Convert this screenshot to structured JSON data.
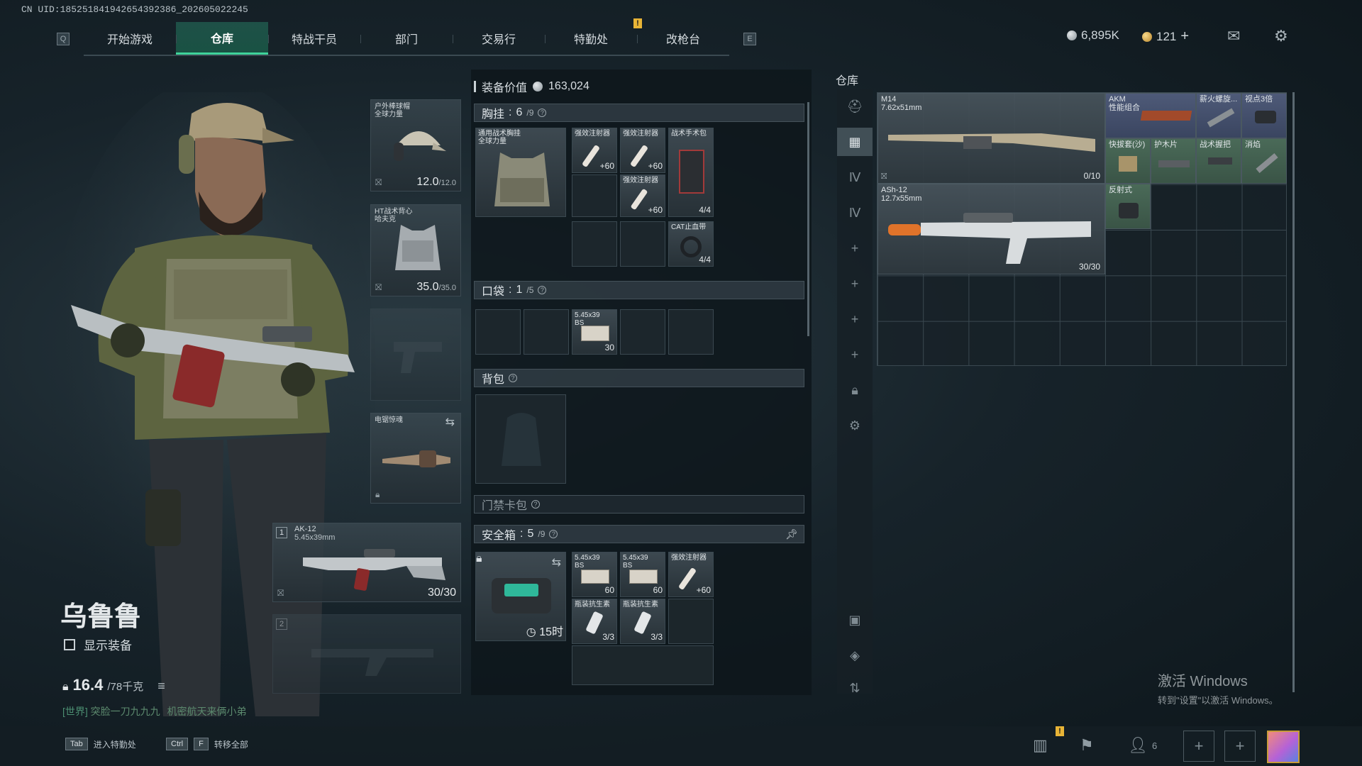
{
  "uid_text": "CN UID:185251841942654392386_202605022245",
  "nav": {
    "left_key": "Q",
    "right_key": "E",
    "tabs": [
      "开始游戏",
      "仓库",
      "特战干员",
      "部门",
      "交易行",
      "特勤处",
      "改枪台"
    ],
    "active_tab": "仓库",
    "warn_mark": "!"
  },
  "currency": {
    "silver": "6,895K",
    "gold": "121",
    "gold_plus": "+"
  },
  "operator": {
    "name": "乌鲁鲁",
    "show_gear_label": "显示装备",
    "weight": "16.4",
    "weight_max": "/78千克"
  },
  "chat": {
    "channel": "[世界]",
    "sender": "突脸一刀九九九",
    "message": "机密航天来俩小弟"
  },
  "gear_slots": {
    "helmet": {
      "label": "户外棒球帽\n全球力量",
      "value": "12.0",
      "max": "/12.0"
    },
    "armor": {
      "label": "HT战术背心\n哈夫克",
      "value": "35.0",
      "max": "/35.0"
    },
    "melee": {
      "label": "电锯惊魂"
    },
    "primary": {
      "slot_no": "1",
      "name": "AK-12",
      "caliber": "5.45x39mm",
      "ammo": "30/30"
    },
    "secondary": {
      "slot_no": "2"
    }
  },
  "loadout": {
    "equip_value_label": "装备价值",
    "equip_value": "163,024",
    "chest_rig": {
      "title": "胸挂",
      "count": "6",
      "max": "/9",
      "item_label": "通用战术胸挂\n全球力量"
    },
    "chest_items": [
      {
        "label": "强效注射器",
        "value": "+60"
      },
      {
        "label": "强效注射器",
        "value": "+60"
      },
      {
        "label": "强效注射器",
        "value": "+60"
      },
      {
        "label": "战术手术包",
        "value": "4/4"
      },
      {
        "label": "CAT止血带",
        "value": "4/4"
      }
    ],
    "pocket": {
      "title": "口袋",
      "count": "1",
      "max": "/5",
      "item_label": "5.45x39\nBS",
      "item_value": "30"
    },
    "backpack": {
      "title": "背包"
    },
    "keycard": {
      "title": "门禁卡包"
    },
    "safe_box": {
      "title": "安全箱",
      "count": "5",
      "max": "/9",
      "timer": "15时",
      "items": [
        {
          "label": "5.45x39\nBS",
          "value": "60"
        },
        {
          "label": "5.45x39\nBS",
          "value": "60"
        },
        {
          "label": "强效注射器",
          "value": "+60"
        },
        {
          "label": "瓶装抗生素",
          "value": "3/3"
        },
        {
          "label": "瓶装抗生素",
          "value": "3/3"
        }
      ]
    }
  },
  "stash": {
    "title": "仓库",
    "items": [
      {
        "name": "M14",
        "caliber": "7.62x51mm",
        "ammo": "0/10"
      },
      {
        "name": "AKM",
        "sub": "性能组合"
      },
      {
        "name": "薪火螺旋..."
      },
      {
        "name": "视点3倍"
      },
      {
        "name": "快拔套(沙)"
      },
      {
        "name": "护木片"
      },
      {
        "name": "战术握把"
      },
      {
        "name": "消焰"
      },
      {
        "name": "ASh-12",
        "caliber": "12.7x55mm",
        "ammo": "30/30"
      },
      {
        "name": "反射式"
      }
    ]
  },
  "bottom": {
    "hint1_key": "Tab",
    "hint1": "进入特勤处",
    "hint2_key1": "Ctrl",
    "hint2_key2": "F",
    "hint2": "转移全部",
    "friends_count": "6"
  },
  "watermark": {
    "line1": "激活 Windows",
    "line2": "转到\"设置\"以激活 Windows。"
  },
  "colors": {
    "accent": "#3fd49b",
    "warning": "#e8b436",
    "panel": "#0e161b"
  }
}
